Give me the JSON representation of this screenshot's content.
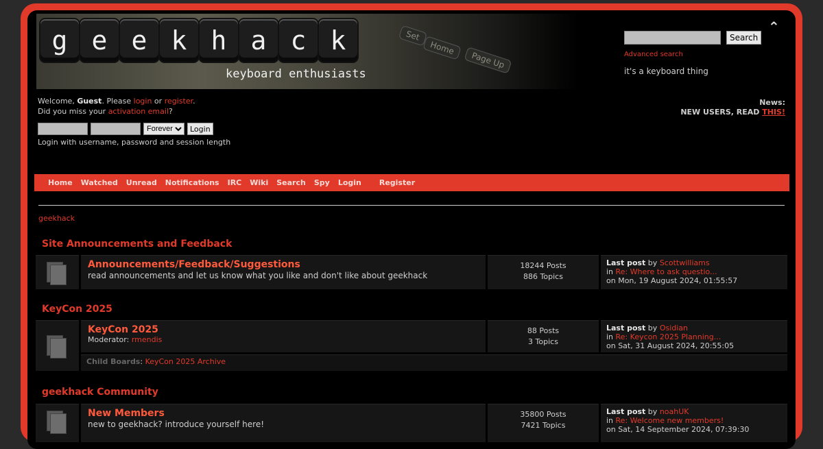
{
  "header": {
    "logo_letters": [
      "g",
      "e",
      "e",
      "k",
      "h",
      "a",
      "c",
      "k"
    ],
    "tagline": "keyboard enthusiasts",
    "bg_keys": [
      "Home",
      "Page Up",
      "Set"
    ],
    "search_button": "Search",
    "advanced_search": "Advanced search",
    "slogan": "it's a keyboard thing"
  },
  "user": {
    "welcome": "Welcome, ",
    "guest": "Guest",
    "please": ". Please ",
    "login": "login",
    "or": " or ",
    "register": "register",
    "dot": ".",
    "missed": "Did you miss your ",
    "activation": "activation email",
    "q": "?",
    "session_option": "Forever",
    "login_button": "Login",
    "hint": "Login with username, password and session length"
  },
  "news": {
    "label": "News:",
    "text": "NEW USERS, READ ",
    "link": "THIS!"
  },
  "nav": [
    "Home",
    "Watched",
    "Unread",
    "Notifications",
    "IRC",
    "Wiki",
    "Search",
    "Spy",
    "Login",
    "Register"
  ],
  "breadcrumb": "geekhack",
  "categories": [
    {
      "name": "Site Announcements and Feedback",
      "board": {
        "title": "Announcements/Feedback/Suggestions",
        "desc": "read announcements and let us know what you like and don't like about geekhack",
        "posts": "18244 Posts",
        "topics": "886 Topics",
        "last_label": "Last post",
        "by": " by ",
        "last_user": "Scottwilliams",
        "in": "in ",
        "last_topic": "Re: Where to ask questio...",
        "last_date": "on Mon, 19 August 2024, 01:55:57"
      }
    },
    {
      "name": "KeyCon 2025",
      "board": {
        "title": "KeyCon 2025",
        "moderator_label": "Moderator: ",
        "moderator": "rmendis",
        "posts": "88 Posts",
        "topics": "3 Topics",
        "last_label": "Last post",
        "by": " by ",
        "last_user": "Osidian",
        "in": "in ",
        "last_topic": "Re: Keycon 2025 Planning...",
        "last_date": "on Sat, 31 August 2024, 20:55:05",
        "child_label": "Child Boards",
        "child_sep": ": ",
        "child_board": "KeyCon 2025 Archive"
      }
    },
    {
      "name": "geekhack Community",
      "board": {
        "title": "New Members",
        "desc": "new to geekhack? introduce yourself here!",
        "posts": "35800 Posts",
        "topics": "7421 Topics",
        "last_label": "Last post",
        "by": " by ",
        "last_user": "noahUK",
        "in": "in ",
        "last_topic": "Re: Welcome new members!",
        "last_date": "on Sat, 14 September 2024, 07:39:30"
      }
    }
  ],
  "colors": {
    "accent": "#e23a2a",
    "background": "#000000",
    "frame": "#2a2a2a"
  }
}
